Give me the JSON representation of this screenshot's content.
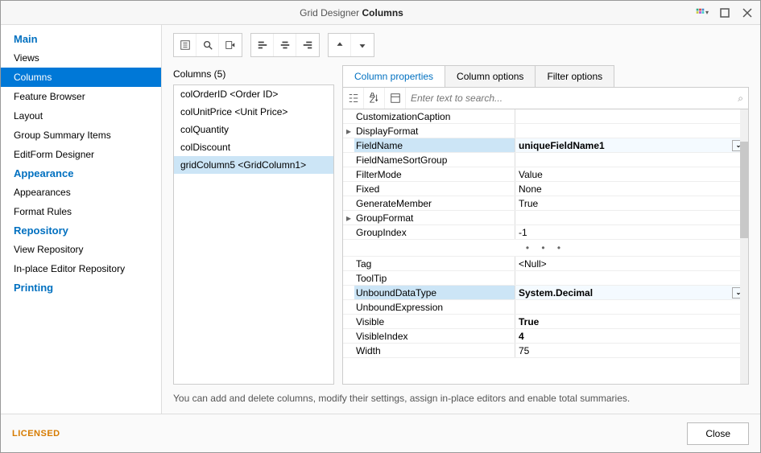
{
  "titlebar": {
    "prefix": "Grid Designer",
    "suffix": "Columns"
  },
  "sidebar": {
    "sections": [
      {
        "header": "Main",
        "items": [
          "Views",
          "Columns",
          "Feature Browser",
          "Layout",
          "Group Summary Items",
          "EditForm Designer"
        ],
        "selected": 1
      },
      {
        "header": "Appearance",
        "items": [
          "Appearances",
          "Format Rules"
        ]
      },
      {
        "header": "Repository",
        "items": [
          "View Repository",
          "In-place Editor Repository"
        ]
      },
      {
        "header": "Printing",
        "items": []
      }
    ]
  },
  "columns": {
    "header": "Columns (5)",
    "items": [
      "colOrderID <Order ID>",
      "colUnitPrice <Unit Price>",
      "colQuantity",
      "colDiscount",
      "gridColumn5 <GridColumn1>"
    ],
    "selected": 4
  },
  "tabs": {
    "items": [
      "Column properties",
      "Column options",
      "Filter options"
    ],
    "active": 0
  },
  "search": {
    "placeholder": "Enter text to search..."
  },
  "props_top": [
    {
      "name": "CustomizationCaption",
      "val": ""
    },
    {
      "name": "DisplayFormat",
      "val": "",
      "expand": true
    },
    {
      "name": "FieldName",
      "val": "uniqueFieldName1",
      "bold": true,
      "sel": true,
      "dd": true
    },
    {
      "name": "FieldNameSortGroup",
      "val": ""
    },
    {
      "name": "FilterMode",
      "val": "Value"
    },
    {
      "name": "Fixed",
      "val": "None"
    },
    {
      "name": "GenerateMember",
      "val": "True"
    },
    {
      "name": "GroupFormat",
      "val": "",
      "expand": true
    },
    {
      "name": "GroupIndex",
      "val": "-1"
    }
  ],
  "props_bottom": [
    {
      "name": "Tag",
      "val": "<Null>"
    },
    {
      "name": "ToolTip",
      "val": ""
    },
    {
      "name": "UnboundDataType",
      "val": "System.Decimal",
      "bold": true,
      "sel": true,
      "dd": true
    },
    {
      "name": "UnboundExpression",
      "val": ""
    },
    {
      "name": "Visible",
      "val": "True",
      "bold": true
    },
    {
      "name": "VisibleIndex",
      "val": "4",
      "bold": true
    },
    {
      "name": "Width",
      "val": "75"
    }
  ],
  "description": "You can add and delete columns, modify their settings, assign in-place editors and enable total summaries.",
  "footer": {
    "licensed": "LICENSED",
    "close": "Close"
  }
}
